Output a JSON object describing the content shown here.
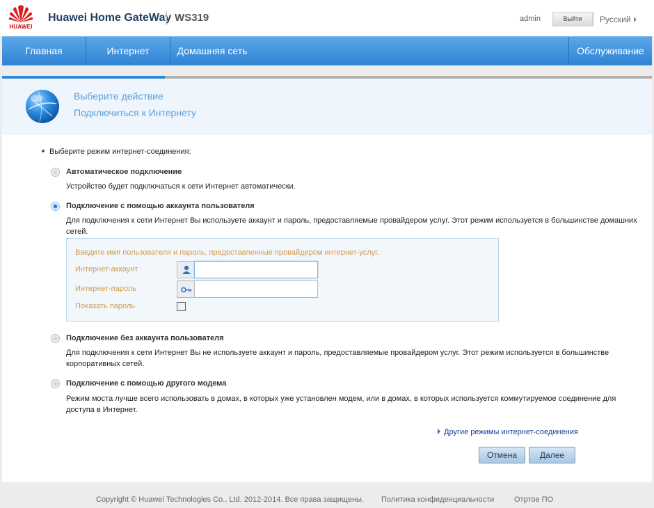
{
  "header": {
    "logo_text": "HUAWEI",
    "brand": "Huawei Home GateWay",
    "model": "WS319",
    "user": "admin",
    "logout_label": "Выйти",
    "language": "Русский"
  },
  "nav": {
    "items": [
      {
        "label": "Главная"
      },
      {
        "label": "Интернет"
      },
      {
        "label": "Домашняя сеть"
      },
      {
        "label": "Обслуживание"
      }
    ]
  },
  "wizard": {
    "progress_percent": 25
  },
  "banner": {
    "line1": "Выберите действие",
    "line2": "Подключиться к Интернету"
  },
  "content": {
    "prompt": "Выберите режим интернет-соединения:",
    "options": [
      {
        "title": "Автоматическое подключение",
        "description": "Устройство будет подключаться к сети Интернет автоматически.",
        "selected": false
      },
      {
        "title": "Подключение с помощью аккаунта пользователя",
        "description": "Для подключения к сети Интернет Вы используете аккаунт и пароль, предоставляемые провайдером услуг. Этот режим используется в большинстве домашних сетей.",
        "selected": true
      },
      {
        "title": "Подключение без аккаунта пользователя",
        "description": "Для подключения к сети Интернет Вы не используете аккаунт и пароль, предоставляемые провайдером услуг. Этот режим используется в большинстве корпоративных сетей.",
        "selected": false
      },
      {
        "title": "Подключение с помощью другого модема",
        "description": "Режим моста лучше всего использовать в домах, в которых уже установлен модем, или в домах, в которых используется коммутируемое соединение для доступа в Интернет.",
        "selected": false
      }
    ],
    "form": {
      "hint": "Введите имя пользователя и пароль, предоставленные провайдером интернет-услуг.",
      "account_label": "Интернет-аккаунт",
      "account_value": "",
      "password_label": "Интернет-пароль",
      "password_value": "",
      "show_password_label": "Показать пароль",
      "show_password_checked": false,
      "account_icon": "user-icon",
      "password_icon": "key-icon"
    },
    "more_link": "Другие режимы интернет-соединения",
    "cancel_label": "Отмена",
    "next_label": "Далее"
  },
  "footer": {
    "copyright": "Copyright © Huawei Technologies Co., Ltd. 2012-2014. Все права защищены.",
    "privacy": "Политика конфиденциальности",
    "open_source": "Отртое ПО"
  },
  "colors": {
    "nav": "#3a8fdc",
    "banner": "#eef5fc",
    "accent_text": "#5d9fd6",
    "form_label": "#d09a50"
  }
}
